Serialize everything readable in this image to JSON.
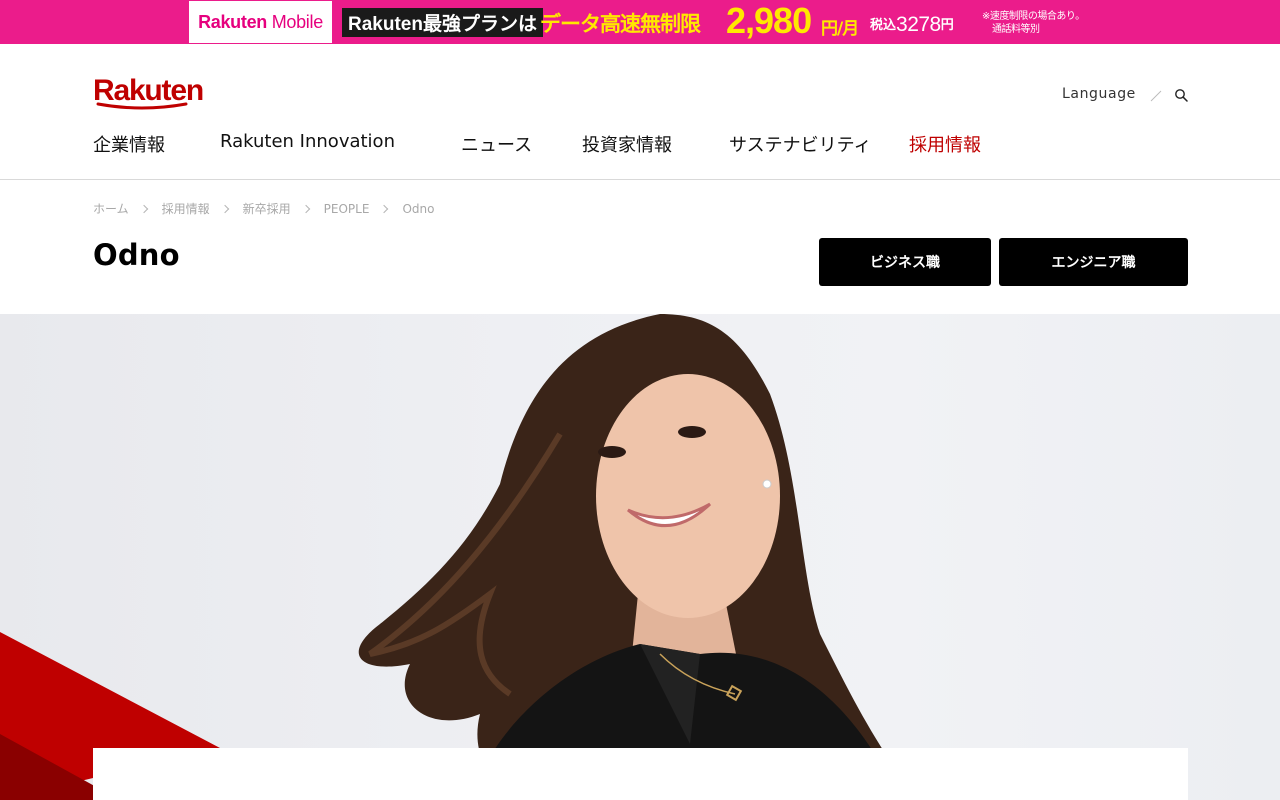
{
  "promo": {
    "logo_brand": "Rakuten",
    "logo_product": "Mobile",
    "plan_text": "Rakuten最強プランは",
    "data_text": "データ高速無制限",
    "price": "2,980",
    "price_unit": "円/月",
    "tax_label": "税込",
    "tax_price": "3278",
    "tax_unit": "円",
    "note_line1": "※速度制限の場合あり。",
    "note_line2": "通話料等別",
    "colors": {
      "background": "#eb1c8b",
      "highlight": "#ffe800"
    }
  },
  "header": {
    "logo_text": "Rakuten",
    "language_label": "Language",
    "nav": [
      {
        "label": "企業情報",
        "active": false
      },
      {
        "label": "Rakuten Innovation",
        "active": false
      },
      {
        "label": "ニュース",
        "active": false
      },
      {
        "label": "投資家情報",
        "active": false
      },
      {
        "label": "サステナビリティ",
        "active": false
      },
      {
        "label": "採用情報",
        "active": true
      }
    ],
    "colors": {
      "brand": "#bf0000"
    }
  },
  "breadcrumb": [
    "ホーム",
    "採用情報",
    "新卒採用",
    "PEOPLE",
    "Odno"
  ],
  "page": {
    "title": "Odno",
    "buttons": {
      "business": "ビジネス職",
      "engineer": "エンジニア職"
    }
  }
}
